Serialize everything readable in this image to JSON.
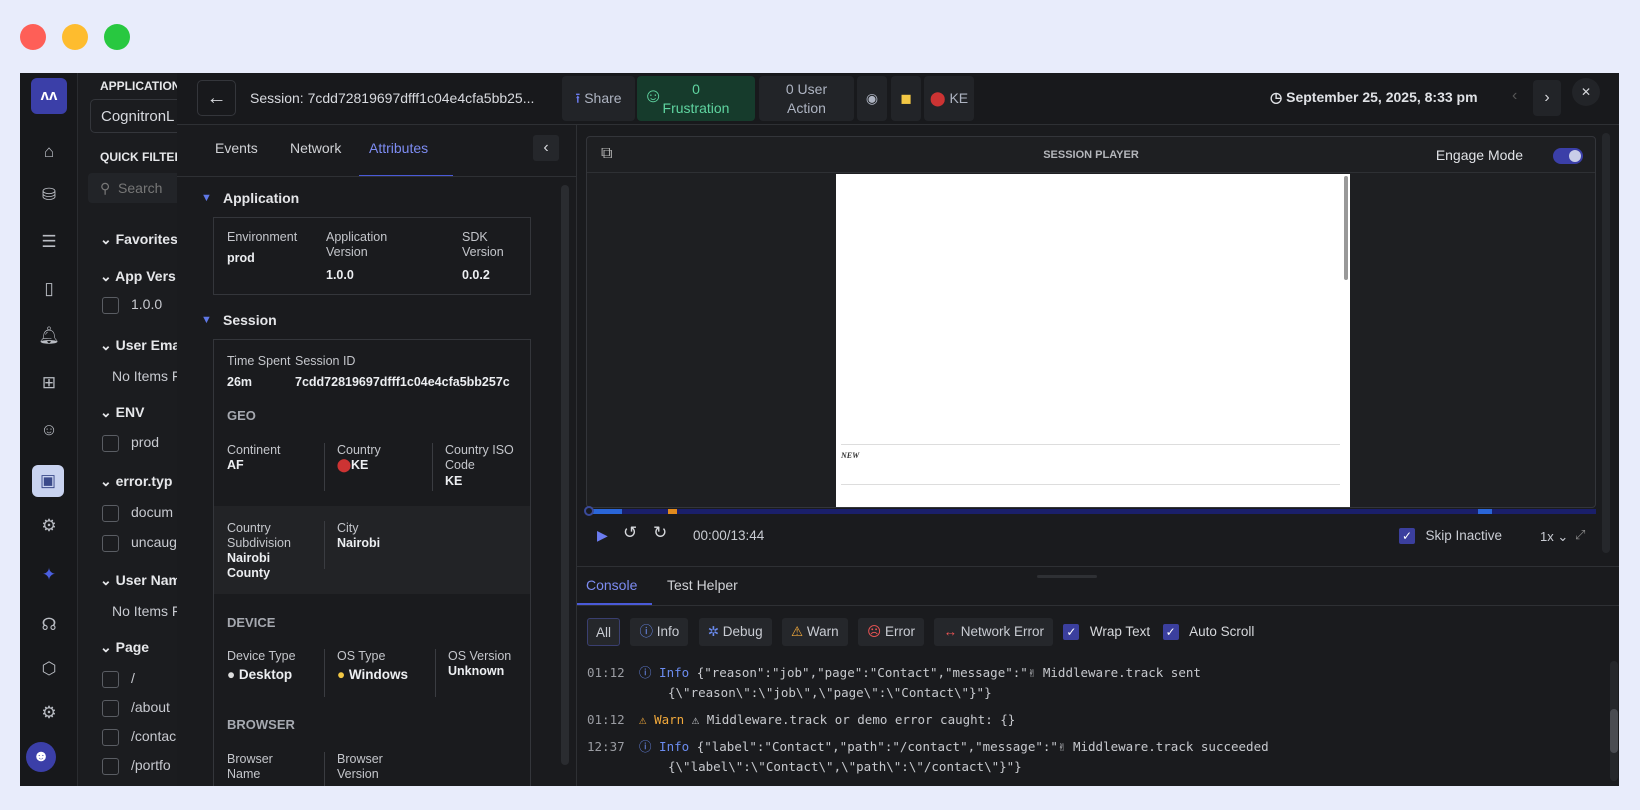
{
  "colors": {
    "background": "#e8ecfb",
    "accent": "#6b7cf0",
    "close": "#fe5f57",
    "minimize": "#febc2e",
    "maximize": "#28c840",
    "frustration_bg": "#163b2c"
  },
  "filters": {
    "application_label": "APPLICATION",
    "application_value": "CognitronL",
    "quick_filters": "QUICK FILTER",
    "search_placeholder": "Search",
    "groups": [
      {
        "title": "Favorites"
      },
      {
        "title": "App Vers",
        "items": [
          "1.0.0"
        ]
      },
      {
        "title": "User Ema",
        "empty": "No Items F"
      },
      {
        "title": "ENV",
        "items": [
          "prod"
        ]
      },
      {
        "title": "error.typ",
        "items": [
          "docum",
          "uncaug"
        ]
      },
      {
        "title": "User Nam",
        "empty": "No Items F"
      },
      {
        "title": "Page",
        "items": [
          "/",
          "/about",
          "/contac",
          "/portfo"
        ]
      }
    ]
  },
  "header": {
    "session_title": "Session: 7cdd72819697dfff1c04e4cfa5bb25...",
    "share": "Share",
    "frustration_count": "0",
    "frustration_label": "Frustration",
    "user_action_count": "0 User",
    "user_action_label": "Action",
    "country": "KE",
    "datetime": "September 25, 2025, 8:33 pm"
  },
  "tabs": [
    "Events",
    "Network",
    "Attributes"
  ],
  "attributes": {
    "application": {
      "title": "Application",
      "environment_label": "Environment",
      "environment": "prod",
      "app_version_label": "Application Version",
      "app_version": "1.0.0",
      "sdk_version_label": "SDK Version",
      "sdk_version": "0.0.2"
    },
    "session": {
      "title": "Session",
      "time_spent_label": "Time Spent",
      "session_id_label": "Session ID",
      "time_spent": "26m",
      "session_id": "7cdd72819697dfff1c04e4cfa5bb257c"
    },
    "geo": {
      "title": "GEO",
      "continent_label": "Continent",
      "continent": "AF",
      "country_label": "Country",
      "country": "KE",
      "iso_label": "Country ISO Code",
      "iso": "KE",
      "subdivision_label": "Country Subdivision",
      "subdivision": "Nairobi County",
      "city_label": "City",
      "city": "Nairobi"
    },
    "device": {
      "title": "DEVICE",
      "device_type_label": "Device Type",
      "device_type": "Desktop",
      "os_type_label": "OS Type",
      "os_type": "Windows",
      "os_version_label": "OS Version",
      "os_version": "Unknown"
    },
    "browser": {
      "title": "BROWSER",
      "name_label": "Browser Name",
      "version_label": "Browser Version"
    }
  },
  "player": {
    "title": "SESSION PLAYER",
    "engage_mode": "Engage Mode",
    "page_text": "NEW",
    "time": "00:00/13:44",
    "played_fraction": 0,
    "skip_inactive": "Skip Inactive",
    "speed": "1x"
  },
  "console": {
    "tabs": [
      "Console",
      "Test Helper"
    ],
    "filters": [
      "All",
      "Info",
      "Debug",
      "Warn",
      "Error",
      "Network Error"
    ],
    "wrap_text": "Wrap Text",
    "auto_scroll": "Auto Scroll",
    "logs": [
      {
        "time": "01:12",
        "level": "Info",
        "line1": "{\"reason\":\"job\",\"page\":\"Contact\",\"message\":\"✌ Middleware.track sent",
        "line2": "{\\\"reason\\\":\\\"job\\\",\\\"page\\\":\\\"Contact\\\"}\"}"
      },
      {
        "time": "01:12",
        "level": "Warn",
        "line1": "⚠ Middleware.track or demo error caught: {}"
      },
      {
        "time": "12:37",
        "level": "Info",
        "line1": "{\"label\":\"Contact\",\"path\":\"/contact\",\"message\":\"✌ Middleware.track succeeded",
        "line2": "{\\\"label\\\":\\\"Contact\\\",\\\"path\\\":\\\"/contact\\\"}\"}"
      }
    ]
  }
}
